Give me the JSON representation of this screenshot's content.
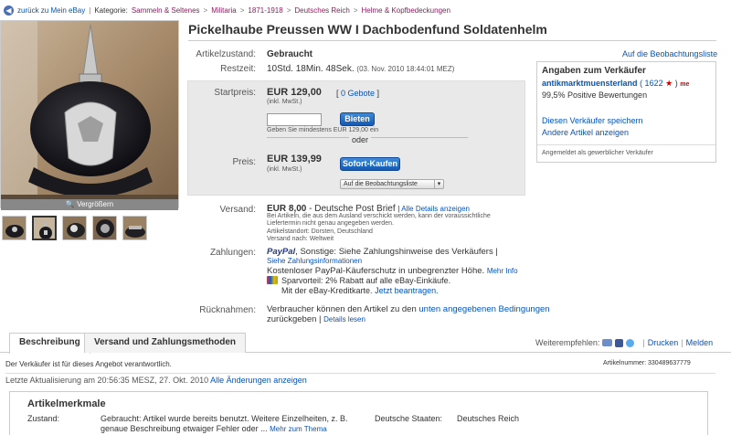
{
  "breadcrumb": {
    "back_label": "zurück zu Mein eBay",
    "category_label": "Kategorie:",
    "items": [
      "Sammeln & Seltenes",
      "Militaria",
      "1871-1918",
      "Deutsches Reich",
      "Helme & Kopfbedeckungen"
    ]
  },
  "images": {
    "enlarge_label": "Vergrößern"
  },
  "item": {
    "title": "Pickelhaube Preussen WW I Dachbodenfund Soldatenhelm",
    "condition_label": "Artikelzustand:",
    "condition_value": "Gebraucht",
    "time_label": "Restzeit:",
    "time_value": "10Std. 18Min. 48Sek.",
    "time_date": "(03. Nov. 2010 18:44:01 MEZ)",
    "watch_link": "Auf die Beobachtungsliste"
  },
  "bid": {
    "start_label": "Startpreis:",
    "start_price": "EUR 129,00",
    "start_tax": "(inkl. MwSt.)",
    "bids_link": "0 Gebote",
    "bid_placeholder": "",
    "bid_button": "Bieten",
    "bid_hint": "Geben Sie mindestens EUR 129,00 ein",
    "or_label": "oder",
    "price_label": "Preis:",
    "price": "EUR 139,99",
    "price_tax": "(inkl. MwSt.)",
    "buy_button": "Sofort-Kaufen",
    "watch_button": "Auf die Beobachtungsliste"
  },
  "shipping": {
    "label": "Versand:",
    "cost": "EUR 8,00",
    "method": "- Deutsche Post Brief",
    "details_link": "Alle Details anzeigen",
    "note": "Bei Artikeln, die aus dem Ausland verschickt werden, kann der voraussichtliche Liefertermin nicht genau angegeben werden.",
    "location": "Artikelstandort: Dorsten, Deutschland",
    "ships_to": "Versand nach: Weltweit"
  },
  "payment": {
    "label": "Zahlungen:",
    "paypal": "PayPal",
    "other": ", Sonstige: Siehe Zahlungshinweise des Verkäufers |",
    "info_link": "Siehe Zahlungsinformationen",
    "protection": "Kostenloser PayPal-Käuferschutz in unbegrenzter Höhe.",
    "more_info_link": "Mehr Info",
    "discount": "Sparvorteil: 2% Rabatt auf alle eBay-Einkäufe.",
    "card": "Mit der eBay-Kreditkarte.",
    "apply_link": "Jetzt beantragen."
  },
  "returns": {
    "label": "Rücknahmen:",
    "text_prefix": "Verbraucher können den Artikel zu den",
    "conditions_link": "unten angegebenen Bedingungen",
    "text_suffix": "zurückgeben |",
    "details_link": "Details lesen"
  },
  "seller": {
    "heading": "Angaben zum Verkäufer",
    "name": "antikmarktmuensterland",
    "score": "( 1622",
    "score_close": ")",
    "me_badge": "me",
    "positive": "99,5% Positive Bewertungen",
    "save_link": "Diesen Verkäufer speichern",
    "other_items_link": "Andere Artikel anzeigen",
    "commercial": "Angemeldet als gewerblicher Verkäufer"
  },
  "tabs": {
    "description": "Beschreibung",
    "shipping_payment": "Versand und Zahlungsmethoden"
  },
  "share": {
    "label": "Weiterempfehlen:",
    "print": "Drucken",
    "report": "Melden"
  },
  "description": {
    "responsible": "Der Verkäufer ist für dieses Angebot verantwortlich.",
    "item_number": "Artikelnummer: 330489637779",
    "updated_prefix": "Letzte Aktualisierung am 20:56:35 MESZ, 27. Okt. 2010",
    "changes_link": "Alle Änderungen anzeigen"
  },
  "attributes": {
    "heading": "Artikelmerkmale",
    "condition_label": "Zustand:",
    "condition_text": "Gebraucht: Artikel wurde bereits benutzt. Weitere Einzelheiten, z. B.",
    "condition_text2": "genaue Beschreibung etwaiger Fehler oder ...",
    "more_link": "Mehr zum Thema",
    "states_label": "Deutsche Staaten:",
    "states_value": "Deutsches Reich"
  },
  "colors": {
    "link": "#0654ba",
    "button_blue": "#1459b4",
    "price_box_bg": "#e9e9e9"
  }
}
